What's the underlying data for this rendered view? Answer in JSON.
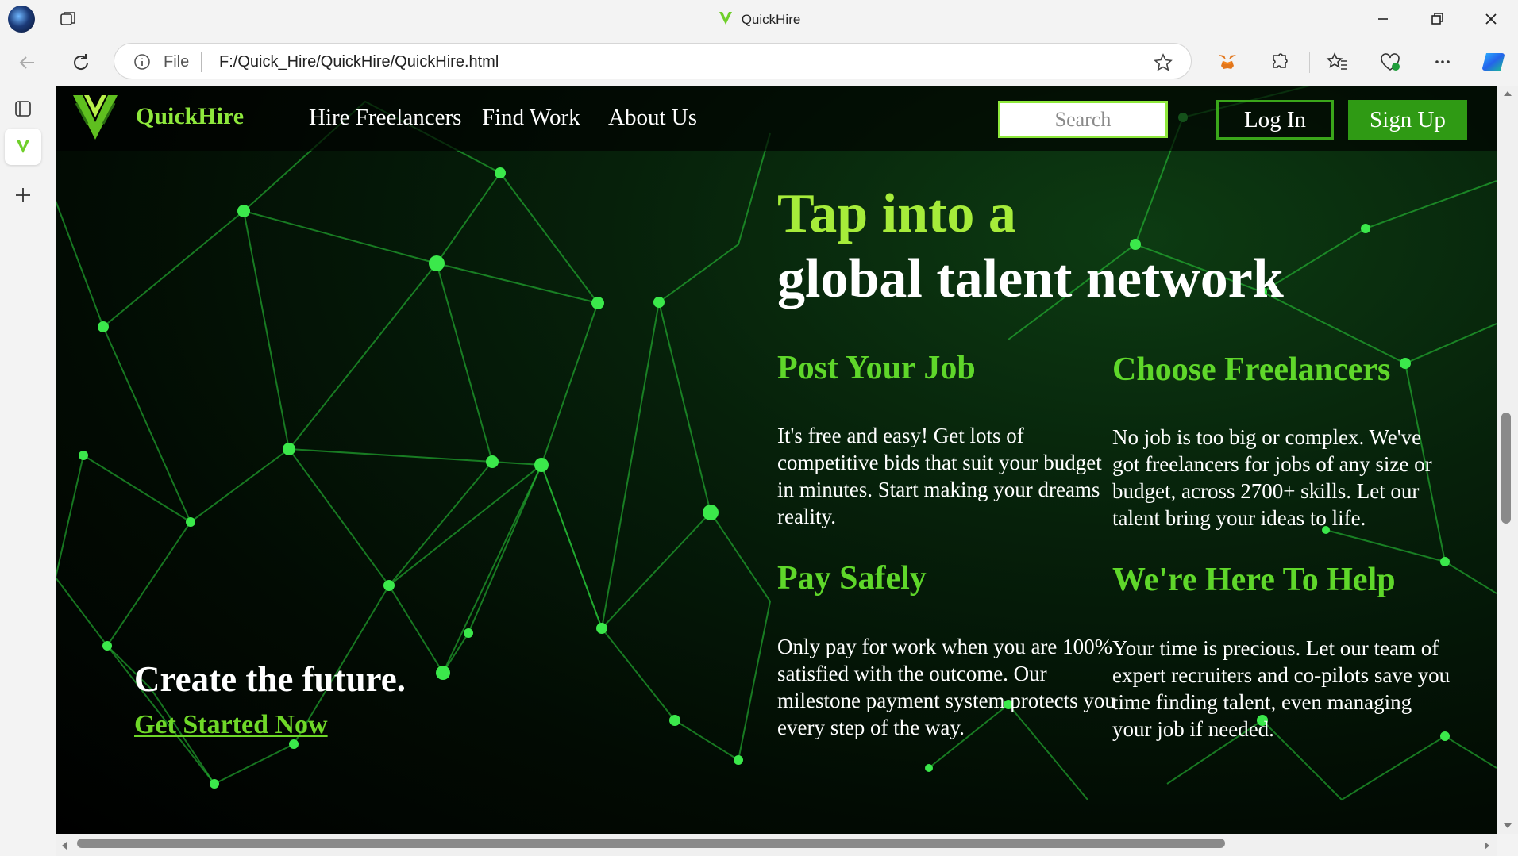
{
  "browser": {
    "tab_title": "QuickHire",
    "address": {
      "scheme_label": "File",
      "url": "F:/Quick_Hire/QuickHire/QuickHire.html"
    }
  },
  "site": {
    "brand": "QuickHire",
    "nav": [
      "Hire Freelancers",
      "Find Work",
      "About Us"
    ],
    "search_placeholder": "Search",
    "login_label": "Log In",
    "signup_label": "Sign Up"
  },
  "hero": {
    "line1": "Tap into a",
    "line2": "global talent network"
  },
  "features": [
    {
      "title": "Post Your Job",
      "text": "It's free and easy! Get lots of competitive bids that suit your budget in minutes. Start making your dreams reality."
    },
    {
      "title": "Choose Freelancers",
      "text": "No job is too big or complex. We've got freelancers for jobs of any size or budget, across 2700+ skills. Let our talent bring your ideas to life."
    },
    {
      "title": "Pay Safely",
      "text": "Only pay for work when you are 100% satisfied with the outcome. Our milestone payment system protects you every step of the way."
    },
    {
      "title": "We're Here To Help",
      "text": "Your time is precious. Let our team of expert recruiters and co-pilots save you time finding talent, even managing your job if needed."
    }
  ],
  "cta": {
    "title": "Create the future.",
    "link": "Get Started Now"
  },
  "colors": {
    "accent_green": "#8ee83c",
    "heading_green": "#5fd72a",
    "button_green": "#2f9a14"
  }
}
